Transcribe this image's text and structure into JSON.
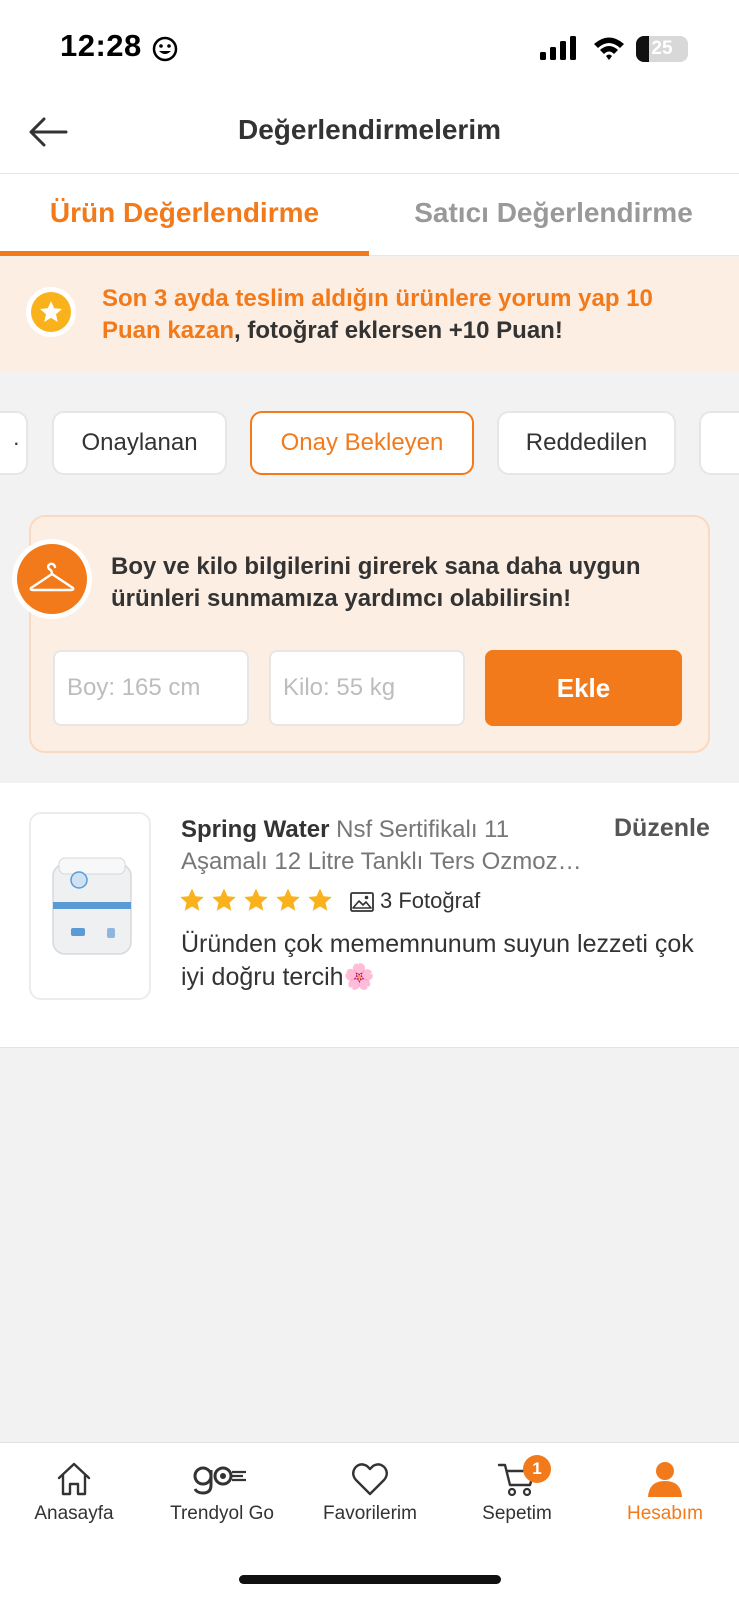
{
  "status_bar": {
    "time": "12:28",
    "battery": "25",
    "battery_level": 0.25
  },
  "header": {
    "title": "Değerlendirmelerim"
  },
  "tabs": [
    {
      "label": "Ürün Değerlendirme",
      "active": true
    },
    {
      "label": "Satıcı Değerlendirme",
      "active": false
    }
  ],
  "promo": {
    "highlight": "Son 3 ayda teslim aldığın ürünlere yorum yap 10 Puan kazan",
    "rest": ", fotoğraf eklersen +10 Puan!"
  },
  "filters": [
    {
      "label": "Onaylanan",
      "selected": false
    },
    {
      "label": "Onay Bekleyen",
      "selected": true
    },
    {
      "label": "Reddedilen",
      "selected": false
    }
  ],
  "body_info": {
    "message": "Boy ve kilo bilgilerini girerek sana daha uygun ürünleri sunmamıza yardımcı olabilirsin!",
    "height_placeholder": "Boy: 165 cm",
    "weight_placeholder": "Kilo: 55 kg",
    "add_label": "Ekle"
  },
  "review": {
    "brand": "Spring Water",
    "product_name": "Nsf Sertifikalı 11 Aşamalı 12 Litre Tanklı Ters Ozmoz…",
    "edit_label": "Düzenle",
    "rating": 5,
    "photo_count_label": "3 Fotoğraf",
    "text": "Üründen çok mememnunum suyun lezzeti çok iyi doğru tercih🌸"
  },
  "bottom_nav": {
    "items": [
      {
        "label": "Anasayfa",
        "icon": "home-icon"
      },
      {
        "label": "Trendyol Go",
        "icon": "trendyol-go-icon"
      },
      {
        "label": "Favorilerim",
        "icon": "heart-icon"
      },
      {
        "label": "Sepetim",
        "icon": "cart-icon"
      },
      {
        "label": "Hesabım",
        "icon": "user-icon",
        "active": true
      }
    ],
    "cart_badge": "1"
  },
  "colors": {
    "accent": "#f27a1a",
    "promo_bg": "#fdeee4",
    "star": "#f9b21b"
  }
}
